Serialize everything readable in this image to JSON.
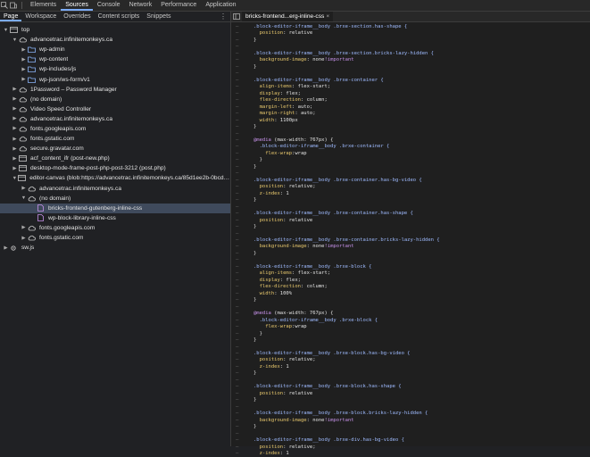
{
  "toolbar": {
    "tabs": [
      {
        "label": "Elements",
        "active": false
      },
      {
        "label": "Sources",
        "active": true
      },
      {
        "label": "Console",
        "active": false
      },
      {
        "label": "Network",
        "active": false
      },
      {
        "label": "Performance",
        "active": false
      },
      {
        "label": "Application",
        "active": false
      }
    ]
  },
  "navigator": {
    "tabs": [
      {
        "label": "Page",
        "active": true
      },
      {
        "label": "Workspace",
        "active": false
      },
      {
        "label": "Overrides",
        "active": false
      },
      {
        "label": "Content scripts",
        "active": false
      },
      {
        "label": "Snippets",
        "active": false
      }
    ],
    "tree": [
      {
        "label": "top",
        "depth": 0,
        "arrow": "down",
        "icon": "frame-icon"
      },
      {
        "label": "advancetrac.infinitemonkeys.ca",
        "depth": 1,
        "arrow": "down",
        "icon": "cloud-icon"
      },
      {
        "label": "wp-admin",
        "depth": 2,
        "arrow": "right",
        "icon": "folder-icon"
      },
      {
        "label": "wp-content",
        "depth": 2,
        "arrow": "right",
        "icon": "folder-icon"
      },
      {
        "label": "wp-includes/js",
        "depth": 2,
        "arrow": "right",
        "icon": "folder-icon"
      },
      {
        "label": "wp-json/ws-form/v1",
        "depth": 2,
        "arrow": "right",
        "icon": "folder-icon"
      },
      {
        "label": "1Password – Password Manager",
        "depth": 1,
        "arrow": "right",
        "icon": "cloud-icon"
      },
      {
        "label": "(no domain)",
        "depth": 1,
        "arrow": "right",
        "icon": "cloud-icon"
      },
      {
        "label": "Video Speed Controller",
        "depth": 1,
        "arrow": "right",
        "icon": "cloud-icon"
      },
      {
        "label": "advancetrac.infinitemonkeys.ca",
        "depth": 1,
        "arrow": "right",
        "icon": "cloud-icon"
      },
      {
        "label": "fonts.googleapis.com",
        "depth": 1,
        "arrow": "right",
        "icon": "cloud-icon"
      },
      {
        "label": "fonts.gstatic.com",
        "depth": 1,
        "arrow": "right",
        "icon": "cloud-icon"
      },
      {
        "label": "secure.gravatar.com",
        "depth": 1,
        "arrow": "right",
        "icon": "cloud-icon"
      },
      {
        "label": "acf_content_ifr (post-new.php)",
        "depth": 1,
        "arrow": "right",
        "icon": "frame-icon"
      },
      {
        "label": "desktop-mode-frame-post-php-post-3212 (post.php)",
        "depth": 1,
        "arrow": "right",
        "icon": "frame-icon"
      },
      {
        "label": "editor-canvas (blob:https://advancetrac.infinitemonkeys.ca/85d1ee2b-0bcd-44a...",
        "depth": 1,
        "arrow": "down",
        "icon": "frame-icon"
      },
      {
        "label": "advancetrac.infinitemonkeys.ca",
        "depth": 2,
        "arrow": "right",
        "icon": "cloud-icon"
      },
      {
        "label": "(no domain)",
        "depth": 2,
        "arrow": "down",
        "icon": "cloud-icon"
      },
      {
        "label": "bricks-frontend-gutenberg-inline-css",
        "depth": 3,
        "arrow": "none",
        "icon": "file-icon",
        "selected": true
      },
      {
        "label": "wp-block-library-inline-css",
        "depth": 3,
        "arrow": "none",
        "icon": "file-icon"
      },
      {
        "label": "fonts.googleapis.com",
        "depth": 2,
        "arrow": "right",
        "icon": "cloud-icon"
      },
      {
        "label": "fonts.gstatic.com",
        "depth": 2,
        "arrow": "right",
        "icon": "cloud-icon"
      },
      {
        "label": "sw.js",
        "depth": 0,
        "arrow": "right",
        "icon": "gear-icon"
      }
    ]
  },
  "editor": {
    "file_tab": "bricks-frontend...erg-inline-css",
    "lines": [
      [
        {
          "t": ".block-editor-iframe__body .brxe-section.has-shape {",
          "c": "sel-c"
        }
      ],
      [
        {
          "t": "  position",
          "c": "prop"
        },
        {
          "t": ": relative",
          "c": "val"
        }
      ],
      [
        {
          "t": "}",
          "c": "ct"
        }
      ],
      [
        {
          "t": "",
          "c": "ct"
        }
      ],
      [
        {
          "t": ".block-editor-iframe__body .brxe-section.bricks-lazy-hidden {",
          "c": "sel-c"
        }
      ],
      [
        {
          "t": "  background-image",
          "c": "prop"
        },
        {
          "t": ": none",
          "c": "val"
        },
        {
          "t": "!important",
          "c": "imp"
        }
      ],
      [
        {
          "t": "}",
          "c": "ct"
        }
      ],
      [
        {
          "t": "",
          "c": "ct"
        }
      ],
      [
        {
          "t": ".block-editor-iframe__body .brxe-container {",
          "c": "sel-c"
        }
      ],
      [
        {
          "t": "  align-items",
          "c": "prop"
        },
        {
          "t": ": flex-start;",
          "c": "val"
        }
      ],
      [
        {
          "t": "  display",
          "c": "prop"
        },
        {
          "t": ": flex;",
          "c": "val"
        }
      ],
      [
        {
          "t": "  flex-direction",
          "c": "prop"
        },
        {
          "t": ": column;",
          "c": "val"
        }
      ],
      [
        {
          "t": "  margin-left",
          "c": "prop"
        },
        {
          "t": ": auto;",
          "c": "val"
        }
      ],
      [
        {
          "t": "  margin-right",
          "c": "prop"
        },
        {
          "t": ": auto;",
          "c": "val"
        }
      ],
      [
        {
          "t": "  width",
          "c": "prop"
        },
        {
          "t": ": 1100px",
          "c": "val"
        }
      ],
      [
        {
          "t": "}",
          "c": "ct"
        }
      ],
      [
        {
          "t": "",
          "c": "ct"
        }
      ],
      [
        {
          "t": "@media",
          "c": "at"
        },
        {
          "t": " (max-width: 767px) {",
          "c": "val"
        }
      ],
      [
        {
          "t": "  .block-editor-iframe__body .brxe-container {",
          "c": "sel-c"
        }
      ],
      [
        {
          "t": "    flex-wrap",
          "c": "prop"
        },
        {
          "t": ":wrap",
          "c": "val"
        }
      ],
      [
        {
          "t": "  }",
          "c": "ct"
        }
      ],
      [
        {
          "t": "}",
          "c": "ct"
        }
      ],
      [
        {
          "t": "",
          "c": "ct"
        }
      ],
      [
        {
          "t": ".block-editor-iframe__body .brxe-container.has-bg-video {",
          "c": "sel-c"
        }
      ],
      [
        {
          "t": "  position",
          "c": "prop"
        },
        {
          "t": ": relative;",
          "c": "val"
        }
      ],
      [
        {
          "t": "  z-index",
          "c": "prop"
        },
        {
          "t": ": 1",
          "c": "val"
        }
      ],
      [
        {
          "t": "}",
          "c": "ct"
        }
      ],
      [
        {
          "t": "",
          "c": "ct"
        }
      ],
      [
        {
          "t": ".block-editor-iframe__body .brxe-container.has-shape {",
          "c": "sel-c"
        }
      ],
      [
        {
          "t": "  position",
          "c": "prop"
        },
        {
          "t": ": relative",
          "c": "val"
        }
      ],
      [
        {
          "t": "}",
          "c": "ct"
        }
      ],
      [
        {
          "t": "",
          "c": "ct"
        }
      ],
      [
        {
          "t": ".block-editor-iframe__body .brxe-container.bricks-lazy-hidden {",
          "c": "sel-c"
        }
      ],
      [
        {
          "t": "  background-image",
          "c": "prop"
        },
        {
          "t": ": none",
          "c": "val"
        },
        {
          "t": "!important",
          "c": "imp"
        }
      ],
      [
        {
          "t": "}",
          "c": "ct"
        }
      ],
      [
        {
          "t": "",
          "c": "ct"
        }
      ],
      [
        {
          "t": ".block-editor-iframe__body .brxe-block {",
          "c": "sel-c"
        }
      ],
      [
        {
          "t": "  align-items",
          "c": "prop"
        },
        {
          "t": ": flex-start;",
          "c": "val"
        }
      ],
      [
        {
          "t": "  display",
          "c": "prop"
        },
        {
          "t": ": flex;",
          "c": "val"
        }
      ],
      [
        {
          "t": "  flex-direction",
          "c": "prop"
        },
        {
          "t": ": column;",
          "c": "val"
        }
      ],
      [
        {
          "t": "  width",
          "c": "prop"
        },
        {
          "t": ": 100%",
          "c": "val"
        }
      ],
      [
        {
          "t": "}",
          "c": "ct"
        }
      ],
      [
        {
          "t": "",
          "c": "ct"
        }
      ],
      [
        {
          "t": "@media",
          "c": "at"
        },
        {
          "t": " (max-width: 767px) {",
          "c": "val"
        }
      ],
      [
        {
          "t": "  .block-editor-iframe__body .brxe-block {",
          "c": "sel-c"
        }
      ],
      [
        {
          "t": "    flex-wrap",
          "c": "prop"
        },
        {
          "t": ":wrap",
          "c": "val"
        }
      ],
      [
        {
          "t": "  }",
          "c": "ct"
        }
      ],
      [
        {
          "t": "}",
          "c": "ct"
        }
      ],
      [
        {
          "t": "",
          "c": "ct"
        }
      ],
      [
        {
          "t": ".block-editor-iframe__body .brxe-block.has-bg-video {",
          "c": "sel-c"
        }
      ],
      [
        {
          "t": "  position",
          "c": "prop"
        },
        {
          "t": ": relative;",
          "c": "val"
        }
      ],
      [
        {
          "t": "  z-index",
          "c": "prop"
        },
        {
          "t": ": 1",
          "c": "val"
        }
      ],
      [
        {
          "t": "}",
          "c": "ct"
        }
      ],
      [
        {
          "t": "",
          "c": "ct"
        }
      ],
      [
        {
          "t": ".block-editor-iframe__body .brxe-block.has-shape {",
          "c": "sel-c"
        }
      ],
      [
        {
          "t": "  position",
          "c": "prop"
        },
        {
          "t": ": relative",
          "c": "val"
        }
      ],
      [
        {
          "t": "}",
          "c": "ct"
        }
      ],
      [
        {
          "t": "",
          "c": "ct"
        }
      ],
      [
        {
          "t": ".block-editor-iframe__body .brxe-block.bricks-lazy-hidden {",
          "c": "sel-c"
        }
      ],
      [
        {
          "t": "  background-image",
          "c": "prop"
        },
        {
          "t": ": none",
          "c": "val"
        },
        {
          "t": "!important",
          "c": "imp"
        }
      ],
      [
        {
          "t": "}",
          "c": "ct"
        }
      ],
      [
        {
          "t": "",
          "c": "ct"
        }
      ],
      [
        {
          "t": ".block-editor-iframe__body .brxe-div.has-bg-video {",
          "c": "sel-c"
        }
      ],
      [
        {
          "t": "  position",
          "c": "prop"
        },
        {
          "t": ": relative;",
          "c": "val"
        }
      ],
      [
        {
          "t": "  z-index",
          "c": "prop"
        },
        {
          "t": ": 1",
          "c": "val"
        }
      ]
    ]
  }
}
